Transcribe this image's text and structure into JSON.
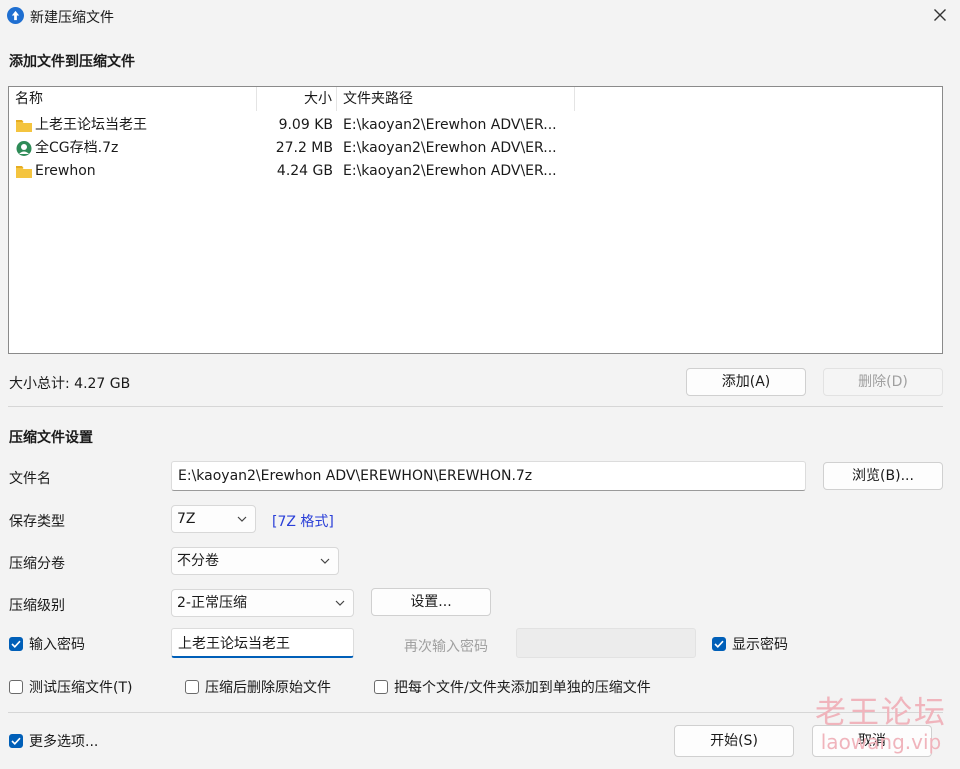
{
  "window": {
    "title": "新建压缩文件"
  },
  "add_section": {
    "title": "添加文件到压缩文件"
  },
  "file_list": {
    "columns": {
      "name": "名称",
      "size": "大小",
      "path": "文件夹路径"
    },
    "rows": [
      {
        "icon": "folder-icon",
        "name": "上老王论坛当老王",
        "size": "9.09 KB",
        "path": "E:\\kaoyan2\\Erewhon ADV\\ER..."
      },
      {
        "icon": "archive-icon",
        "name": "全CG存档.7z",
        "size": "27.2 MB",
        "path": "E:\\kaoyan2\\Erewhon ADV\\ER..."
      },
      {
        "icon": "folder-icon",
        "name": "Erewhon",
        "size": "4.24 GB",
        "path": "E:\\kaoyan2\\Erewhon ADV\\ER..."
      }
    ]
  },
  "summary": {
    "total_label": "大小总计: 4.27 GB"
  },
  "buttons": {
    "add": "添加(A)",
    "delete": "删除(D)",
    "browse": "浏览(B)...",
    "settings": "设置...",
    "start": "开始(S)",
    "cancel": "取消"
  },
  "settings_section": {
    "title": "压缩文件设置"
  },
  "fields": {
    "filename_label": "文件名",
    "filename_value": "E:\\kaoyan2\\Erewhon ADV\\EREWHON\\EREWHON.7z",
    "save_type_label": "保存类型",
    "save_type_value": "7Z",
    "format_link": "[7Z 格式]",
    "volume_label": "压缩分卷",
    "volume_value": "不分卷",
    "level_label": "压缩级别",
    "level_value": "2-正常压缩",
    "password_label": "输入密码",
    "password_value": "上老王论坛当老王",
    "password_repeat_label": "再次输入密码",
    "show_password_label": "显示密码"
  },
  "checkboxes": {
    "password": true,
    "show_password": true,
    "test_archive": {
      "label": "测试压缩文件(T)",
      "checked": false
    },
    "delete_original": {
      "label": "压缩后删除原始文件",
      "checked": false
    },
    "separate_archives": {
      "label": "把每个文件/文件夹添加到单独的压缩文件",
      "checked": false
    },
    "more_options": {
      "label": "更多选项...",
      "checked": true
    }
  },
  "watermark": {
    "line1": "老王论坛",
    "line2": "laowang.vip"
  },
  "colors": {
    "accent": "#005fb8",
    "link": "#2a3fd8",
    "watermark": "#f0b4bc"
  }
}
